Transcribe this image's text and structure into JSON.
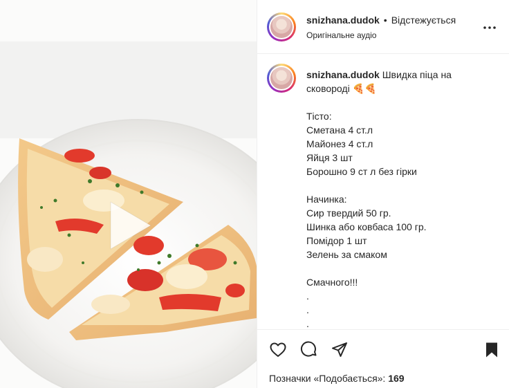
{
  "media": {
    "type": "video",
    "play_icon": "play-icon"
  },
  "post_header": {
    "username": "snizhana.dudok",
    "separator": "•",
    "follow_status": "Відстежується",
    "audio": "Оригінальне аудіо",
    "more_icon": "more-options-icon"
  },
  "caption": {
    "username": "snizhana.dudok",
    "title": "Швидка піца на сковороді 🍕🍕",
    "lines": [
      "",
      "Тісто:",
      "Сметана 4 ст.л",
      "Майонез 4 ст.л",
      "Яйця 3 шт",
      "Борошно 9 ст л без гірки",
      "",
      "Начинка:",
      "Сир твердий 50 гр.",
      "Шинка або ковбаса 100 гр.",
      "Помідор 1 шт",
      "Зелень за смаком",
      "",
      "Смачного!!!",
      ".",
      ".",
      "."
    ]
  },
  "actions": {
    "like_icon": "heart-icon",
    "comment_icon": "comment-icon",
    "share_icon": "share-icon",
    "save_icon": "bookmark-icon"
  },
  "likes": {
    "label": "Позначки «Подобається»:",
    "count": "169"
  },
  "colors": {
    "text": "#262626",
    "border": "#efefef",
    "tomato": "#e23a2c",
    "cheese": "#f5d7a6"
  }
}
